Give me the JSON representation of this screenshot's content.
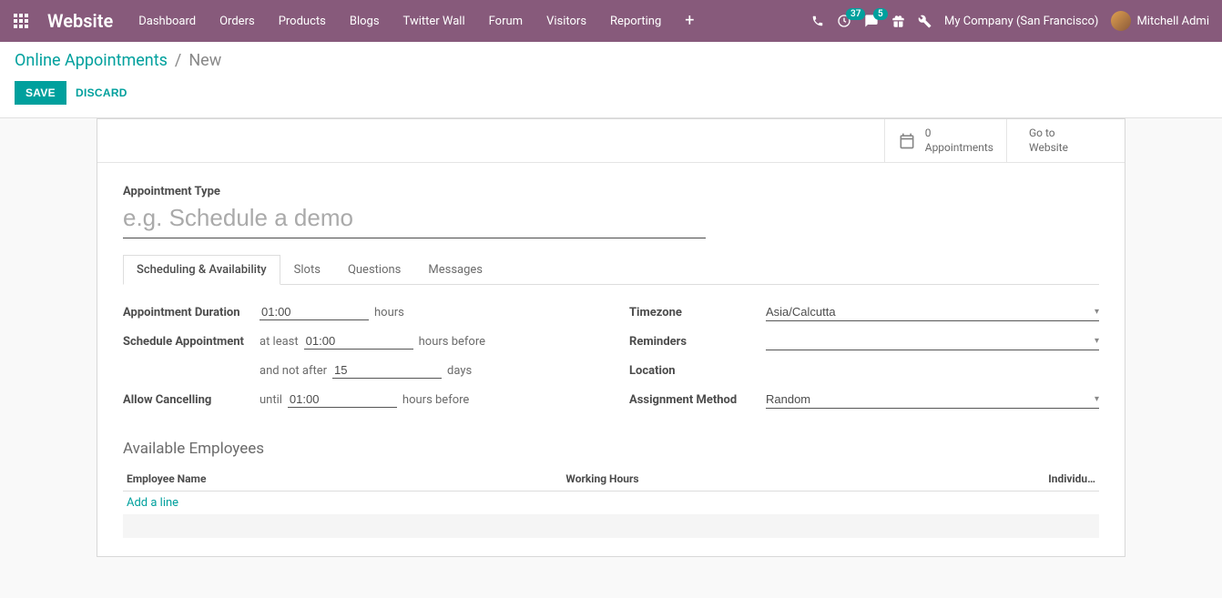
{
  "topbar": {
    "brand": "Website",
    "nav": [
      "Dashboard",
      "Orders",
      "Products",
      "Blogs",
      "Twitter Wall",
      "Forum",
      "Visitors",
      "Reporting"
    ],
    "activity_count": "37",
    "message_count": "5",
    "company": "My Company (San Francisco)",
    "user": "Mitchell Admi"
  },
  "breadcrumb": {
    "parent": "Online Appointments",
    "current": "New"
  },
  "buttons": {
    "save": "SAVE",
    "discard": "DISCARD"
  },
  "statbox": {
    "appointments_count": "0",
    "appointments_label": "Appointments",
    "goto_line1": "Go to",
    "goto_line2": "Website"
  },
  "form": {
    "type_label": "Appointment Type",
    "type_placeholder": "e.g. Schedule a demo",
    "tabs": [
      "Scheduling & Availability",
      "Slots",
      "Questions",
      "Messages"
    ],
    "left": {
      "duration_label": "Appointment Duration",
      "duration_value": "01:00",
      "duration_unit": "hours",
      "schedule_label": "Schedule Appointment",
      "atleast_prefix": "at least",
      "atleast_value": "01:00",
      "atleast_unit": "hours before",
      "notafter_prefix": "and not after",
      "notafter_value": "15",
      "notafter_unit": "days",
      "cancel_label": "Allow Cancelling",
      "cancel_prefix": "until",
      "cancel_value": "01:00",
      "cancel_unit": "hours before"
    },
    "right": {
      "tz_label": "Timezone",
      "tz_value": "Asia/Calcutta",
      "reminders_label": "Reminders",
      "reminders_value": "",
      "location_label": "Location",
      "location_value": "",
      "assign_label": "Assignment Method",
      "assign_value": "Random"
    },
    "employees": {
      "title": "Available Employees",
      "col1": "Employee Name",
      "col2": "Working Hours",
      "col3": "Individu…",
      "add": "Add a line"
    }
  }
}
